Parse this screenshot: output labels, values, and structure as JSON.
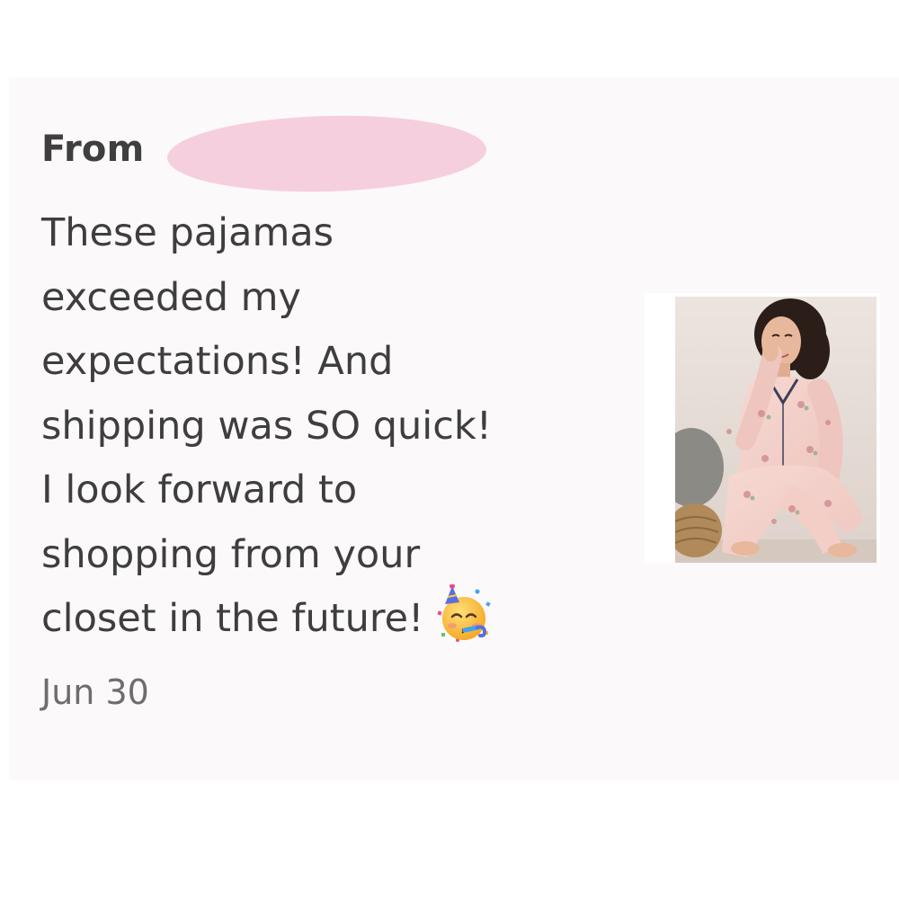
{
  "review": {
    "from_label": "From",
    "message_lines": [
      "These pajamas",
      "exceeded my",
      "expectations! And",
      "shipping was SO quick!",
      "I look forward to",
      "shopping from your",
      "closet in the future!"
    ],
    "emoji": "partying-face-emoji",
    "date": "Jun 30"
  },
  "product": {
    "image": "pink-floral-pajama-set-photo"
  },
  "colors": {
    "card_background": "#fcf9fb",
    "redaction": "#f6cfdf",
    "text": "#3e3e3e",
    "date_text": "#6d6d6d"
  }
}
